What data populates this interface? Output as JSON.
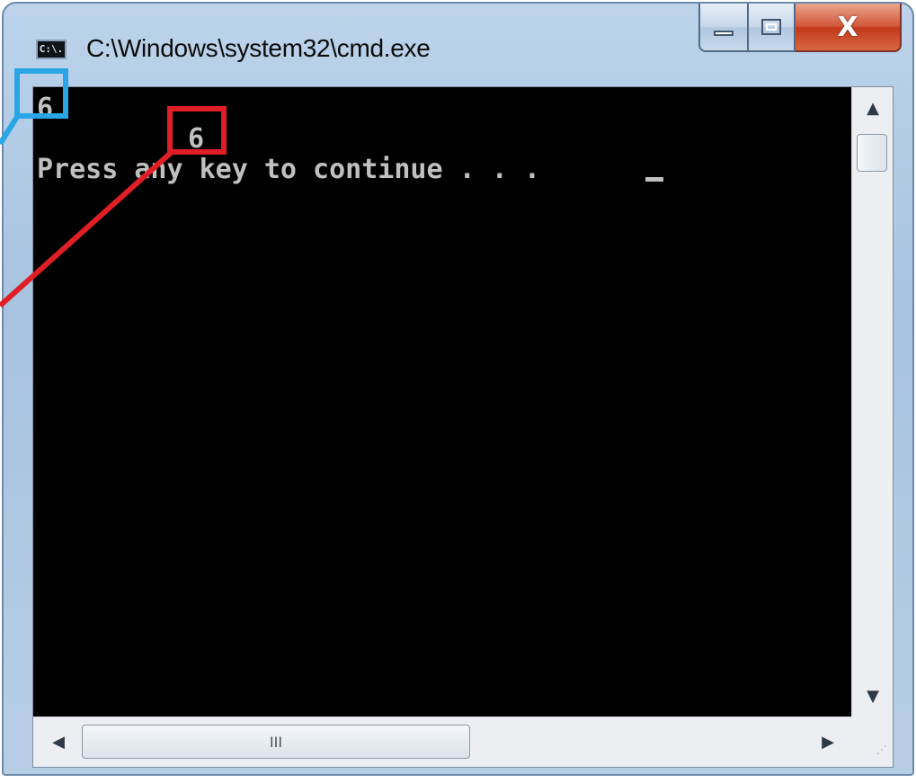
{
  "window": {
    "title": "C:\\Windows\\system32\\cmd.exe",
    "icon_label": "C:\\.",
    "close_glyph": "X"
  },
  "console": {
    "line1": "6",
    "line2": "6",
    "line3": "Press any key to continue . . ."
  },
  "scrollbars": {
    "horizontal_thumb_grip": "III"
  },
  "annotations": {
    "blue_box_color": "#2aa6e6",
    "red_box_color": "#e01e26"
  }
}
